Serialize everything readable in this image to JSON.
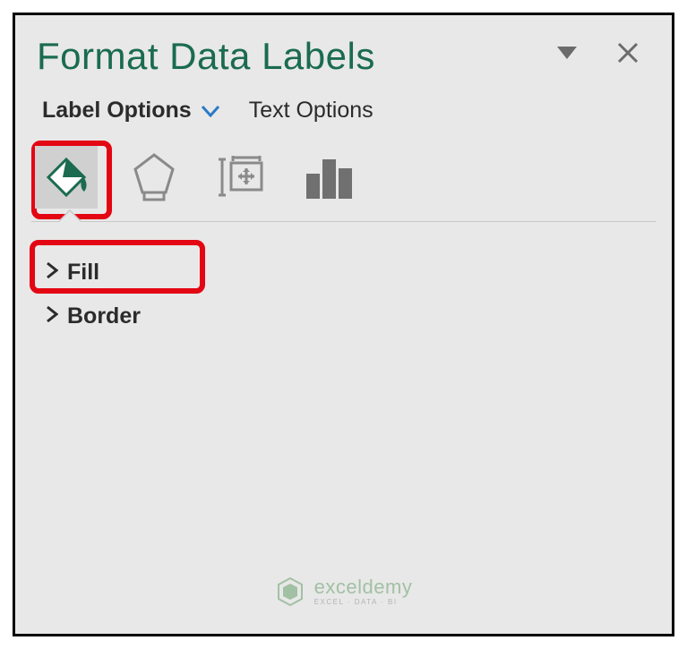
{
  "panel": {
    "title": "Format Data Labels"
  },
  "tabs": {
    "active": "Label Options",
    "inactive": "Text Options"
  },
  "sections": {
    "fill": "Fill",
    "border": "Border"
  },
  "watermark": {
    "name": "exceldemy",
    "tagline": "EXCEL · DATA · BI"
  }
}
